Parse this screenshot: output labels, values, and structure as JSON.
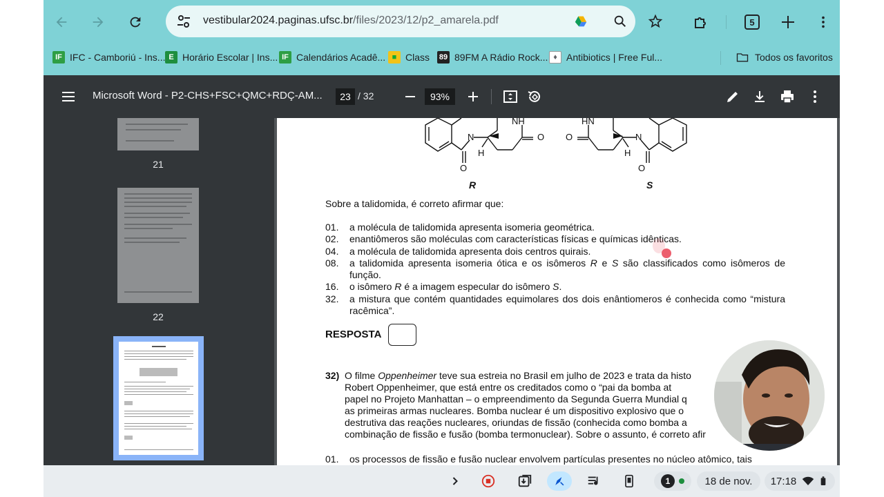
{
  "browser": {
    "url_host": "vestibular2024.paginas.ufsc.br",
    "url_path": "/files/2023/12/p2_amarela.pdf",
    "tab_count": "5"
  },
  "bookmarks": [
    {
      "label": "IFC - Camboriú - Ins...",
      "icon": "ifc-favicon",
      "color": "#2e9e44"
    },
    {
      "label": "Horário Escolar | Ins...",
      "icon": "sheets-favicon",
      "color": "#1e8e3e"
    },
    {
      "label": "Calendários Acadê...",
      "icon": "ifc-favicon",
      "color": "#2e9e44"
    },
    {
      "label": "Class",
      "icon": "class-favicon",
      "color": "#f2c318"
    },
    {
      "label": "89FM A Rádio Rock...",
      "icon": "radio-favicon",
      "color": "#222222"
    },
    {
      "label": "Antibiotics | Free Ful...",
      "icon": "lock-favicon",
      "color": "#5f6368"
    }
  ],
  "bookmarks_all": "Todos os favoritos",
  "pdf": {
    "title": "Microsoft Word - P2-CHS+FSC+QMC+RDÇ-AM...",
    "page_current": "23",
    "page_total": "/  32",
    "zoom": "93%"
  },
  "thumbnails": [
    {
      "number": "21"
    },
    {
      "number": "22"
    }
  ],
  "chem": {
    "label_r": "R",
    "label_s": "S",
    "atom_nh": "NH",
    "atom_hn": "HN",
    "atom_n": "N",
    "atom_h": "H",
    "atom_o": "O"
  },
  "question31": {
    "intro": "Sobre a talidomida, é correto afirmar que:",
    "options": [
      {
        "num": "01.",
        "text": "a molécula de talidomida apresenta isomeria geométrica."
      },
      {
        "num": "02.",
        "text": "enantiômeros são moléculas com características físicas e químicas idênticas."
      },
      {
        "num": "04.",
        "text": "a molécula de talidomida apresenta dois centros quirais."
      },
      {
        "num": "08.",
        "text_a": "a talidomida apresenta isomeria ótica e os isômeros ",
        "r": "R",
        "text_b": " e ",
        "s": "S",
        "text_c": " são classificados como isômeros de função."
      },
      {
        "num": "16.",
        "text_a": "o isômero ",
        "r": "R",
        "text_b": " é a imagem especular do isômero ",
        "s": "S",
        "text_c": "."
      },
      {
        "num": "32.",
        "text": "a mistura que contém quantidades equimolares dos dois enântiomeros é conhecida como “mistura racêmica”."
      }
    ],
    "resposta_label": "RESPOSTA"
  },
  "question32": {
    "number": "32)",
    "line1_a": "O filme ",
    "film": "Oppenheimer",
    "line1_b": " teve sua estreia no Brasil em julho de 2023 e trata da histo",
    "line2": "Robert Oppenheimer, que está entre os creditados como o “pai da bomba at",
    "line3": "papel no Projeto Manhattan – o empreendimento da Segunda Guerra Mundial q",
    "line4": "as primeiras armas nucleares. Bomba nuclear é um dispositivo explosivo que o",
    "line5": "destrutiva das reações nucleares, oriundas de fissão (conhecida como bomba a",
    "line6": "combinação de fissão e fusão (bomba termonuclear). Sobre o assunto, é correto afir",
    "option01_num": "01.",
    "option01_text": "os processos de fissão e fusão nuclear envolvem partículas presentes no núcleo atômico, tais"
  },
  "shelf": {
    "notification_count": "1",
    "date": "18 de nov.",
    "time": "17:18"
  }
}
